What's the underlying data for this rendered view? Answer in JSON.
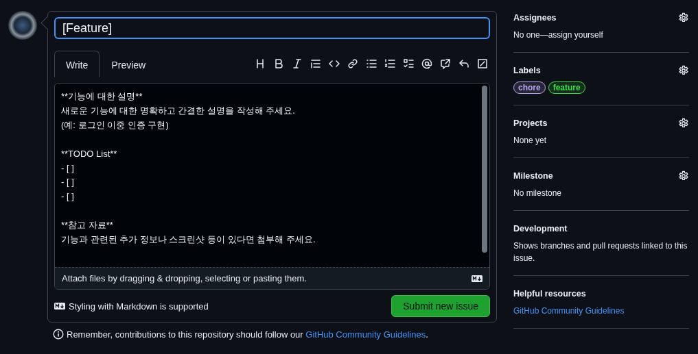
{
  "title_field": {
    "value": "[Feature]"
  },
  "tabs": [
    {
      "label": "Write",
      "selected": true
    },
    {
      "label": "Preview",
      "selected": false
    }
  ],
  "toolbar": [
    {
      "kind": "heading"
    },
    {
      "kind": "bold"
    },
    {
      "kind": "italic"
    },
    {
      "kind": "quote"
    },
    {
      "kind": "code"
    },
    {
      "kind": "link"
    },
    {
      "kind": "bullets"
    },
    {
      "kind": "numbers"
    },
    {
      "kind": "tasks"
    },
    {
      "kind": "mention"
    },
    {
      "kind": "reference"
    },
    {
      "kind": "reply"
    },
    {
      "kind": "fullscreen"
    }
  ],
  "body": {
    "value": "**기능에 대한 설명**\n새로운 기능에 대한 명확하고 간결한 설명을 작성해 주세요.\n(예: 로그인 이중 인증 구현)\n\n**TODO List**\n- [ ]\n- [ ]\n- [ ]\n\n**참고 자료**\n기능과 관련된 추가 정보나 스크린샷 등이 있다면 첨부해 주세요."
  },
  "attach_hint": "Attach files by dragging & dropping, selecting or pasting them.",
  "markdown_note": "Styling with Markdown is supported",
  "submit_button": "Submit new issue",
  "reminder": {
    "text": "Remember, contributions to this repository should follow our ",
    "link": "GitHub Community Guidelines",
    "end": "."
  },
  "sidebar": [
    {
      "title": "Assignees",
      "settings": true,
      "text": "No one—assign yourself"
    },
    {
      "title": "Labels",
      "settings": true,
      "labels": [
        {
          "name": "chore",
          "color": "#b7a4f0"
        },
        {
          "name": "feature",
          "color": "#3fdc4a"
        }
      ]
    },
    {
      "title": "Projects",
      "settings": true,
      "text": "None yet"
    },
    {
      "title": "Milestone",
      "settings": true,
      "text": "No milestone"
    },
    {
      "title": "Development",
      "settings": false,
      "text": "Shows branches and pull requests linked to this issue."
    },
    {
      "title": "Helpful resources",
      "settings": false,
      "link": "GitHub Community Guidelines"
    }
  ]
}
